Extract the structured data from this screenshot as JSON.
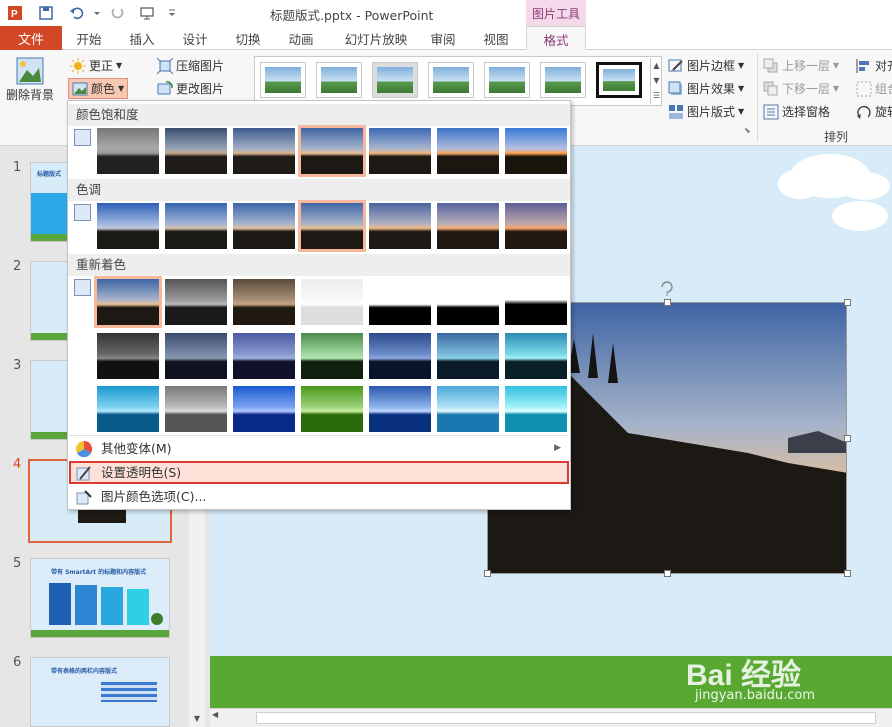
{
  "titlebar": {
    "document_title": "标题版式.pptx - PowerPoint",
    "context_group": "图片工具"
  },
  "tabs": [
    "文件",
    "开始",
    "插入",
    "设计",
    "切换",
    "动画",
    "幻灯片放映",
    "审阅",
    "视图",
    "格式"
  ],
  "ribbon": {
    "remove_background": "删除背景",
    "corrections": "更正",
    "color": "颜色",
    "compress": "压缩图片",
    "change": "更改图片",
    "border": "图片边框",
    "effects": "图片效果",
    "layout": "图片版式",
    "bring_forward": "上移一层",
    "send_backward": "下移一层",
    "selection_pane": "选择窗格",
    "align": "对齐",
    "group": "组合",
    "rotate": "旋转",
    "arrange_label": "排列"
  },
  "dropdown": {
    "section_saturation": "颜色饱和度",
    "section_tone": "色调",
    "section_recolor": "重新着色",
    "more_variations": "其他变体(M)",
    "set_transparent": "设置透明色(S)",
    "color_options": "图片颜色选项(C)..."
  },
  "slides": {
    "numbers": [
      "1",
      "2",
      "3",
      "4",
      "5",
      "6"
    ],
    "thumb1_title": "标题版式",
    "thumb5_title": "带有 SmartArt 的标题和内容版式",
    "thumb6_title": "带有表格的两栏内容版式"
  },
  "watermark": {
    "brand": "Bai 经验",
    "url": "jingyan.baidu.com"
  },
  "colors": {
    "file_tab": "#d24726",
    "context_tab": "#f4d9eb",
    "selection_outline": "#e0643c",
    "highlight_box": "#d93a32",
    "slide_bg": "#d7ebf9",
    "grass": "#58a832"
  }
}
